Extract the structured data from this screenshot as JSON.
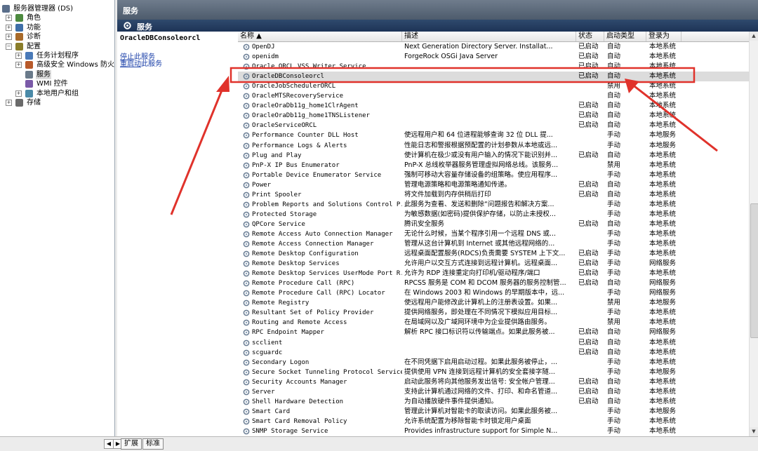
{
  "tree": [
    {
      "label": "服务器管理器 (DS)",
      "level": 0,
      "expander": "",
      "icon": "server-manager-icon"
    },
    {
      "label": "角色",
      "level": 1,
      "expander": "+",
      "icon": "roles-icon"
    },
    {
      "label": "功能",
      "level": 1,
      "expander": "+",
      "icon": "features-icon"
    },
    {
      "label": "诊断",
      "level": 1,
      "expander": "+",
      "icon": "diagnostics-icon"
    },
    {
      "label": "配置",
      "level": 1,
      "expander": "−",
      "icon": "configuration-icon"
    },
    {
      "label": "任务计划程序",
      "level": 2,
      "expander": "+",
      "icon": "task-scheduler-icon"
    },
    {
      "label": "高级安全 Windows 防火墙",
      "level": 2,
      "expander": "+",
      "icon": "firewall-icon"
    },
    {
      "label": "服务",
      "level": 2,
      "expander": "",
      "icon": "services-gear-icon",
      "selected": true
    },
    {
      "label": "WMI 控件",
      "level": 2,
      "expander": "",
      "icon": "wmi-icon"
    },
    {
      "label": "本地用户和组",
      "level": 2,
      "expander": "+",
      "icon": "users-groups-icon"
    },
    {
      "label": "存储",
      "level": 1,
      "expander": "+",
      "icon": "storage-icon"
    }
  ],
  "header": {
    "title": "服务"
  },
  "subheader": {
    "title": "服务"
  },
  "detail": {
    "title": "OracleDBConsoleorcl",
    "link1_link": "停止",
    "link1_rest": "此服务",
    "link2_link": "重启动",
    "link2_rest": "此服务"
  },
  "columns": {
    "name": "名称 ▲",
    "desc": "描述",
    "status": "状态",
    "startup": "启动类型",
    "logon": "登录为"
  },
  "rows": [
    {
      "name": "OpenDJ",
      "desc": "Next Generation Directory Server.  Installat...",
      "status": "已启动",
      "startup": "自动",
      "logon": "本地系统"
    },
    {
      "name": "openidm",
      "desc": "ForgeRock OSGi Java Server",
      "status": "已启动",
      "startup": "自动",
      "logon": "本地系统"
    },
    {
      "name": "Oracle ORCL VSS Writer Service",
      "desc": "",
      "status": "已启动",
      "startup": "自动",
      "logon": "本地系统"
    },
    {
      "name": "OracleDBConsoleorcl",
      "desc": "",
      "status": "已启动",
      "startup": "自动",
      "logon": "本地系统"
    },
    {
      "name": "OracleJobSchedulerORCL",
      "desc": "",
      "status": "",
      "startup": "禁用",
      "logon": "本地系统"
    },
    {
      "name": "OracleMTSRecoveryService",
      "desc": "",
      "status": "",
      "startup": "自动",
      "logon": "本地系统"
    },
    {
      "name": "OracleOraDb11g_home1ClrAgent",
      "desc": "",
      "status": "已启动",
      "startup": "自动",
      "logon": "本地系统"
    },
    {
      "name": "OracleOraDb11g_home1TNSListener",
      "desc": "",
      "status": "已启动",
      "startup": "自动",
      "logon": "本地系统"
    },
    {
      "name": "OracleServiceORCL",
      "desc": "",
      "status": "已启动",
      "startup": "自动",
      "logon": "本地系统"
    },
    {
      "name": "Performance Counter DLL Host",
      "desc": "使远程用户和 64 位进程能够查询 32 位 DLL 提...",
      "status": "",
      "startup": "手动",
      "logon": "本地服务"
    },
    {
      "name": "Performance Logs & Alerts",
      "desc": "性能日志和警报根据预配置的计划参数从本地或远...",
      "status": "",
      "startup": "手动",
      "logon": "本地服务"
    },
    {
      "name": "Plug and Play",
      "desc": "使计算机在极少或没有用户输入的情况下能识别并...",
      "status": "已启动",
      "startup": "自动",
      "logon": "本地系统"
    },
    {
      "name": "PnP-X IP Bus Enumerator",
      "desc": "PnP-X 总线枚举器服务管理虚拟网络总线。该服务...",
      "status": "",
      "startup": "禁用",
      "logon": "本地系统"
    },
    {
      "name": "Portable Device Enumerator Service",
      "desc": "强制可移动大容量存储设备的组策略。使应用程序...",
      "status": "",
      "startup": "手动",
      "logon": "本地系统"
    },
    {
      "name": "Power",
      "desc": "管理电源策略和电源策略通知传递。",
      "status": "已启动",
      "startup": "自动",
      "logon": "本地系统"
    },
    {
      "name": "Print Spooler",
      "desc": "将文件加载到内存供稍后打印",
      "status": "已启动",
      "startup": "自动",
      "logon": "本地系统"
    },
    {
      "name": "Problem Reports and Solutions Control P...",
      "desc": "此服务为查看、发送和删除“问题报告和解决方案...",
      "status": "",
      "startup": "手动",
      "logon": "本地系统"
    },
    {
      "name": "Protected Storage",
      "desc": "为敏感数据(如密码)提供保护存储，以防止未授权...",
      "status": "",
      "startup": "手动",
      "logon": "本地系统"
    },
    {
      "name": "QPCore Service",
      "desc": "腾讯安全服务",
      "status": "已启动",
      "startup": "自动",
      "logon": "本地系统"
    },
    {
      "name": "Remote Access Auto Connection Manager",
      "desc": "无论什么时候，当某个程序引用一个远程 DNS 或...",
      "status": "",
      "startup": "手动",
      "logon": "本地系统"
    },
    {
      "name": "Remote Access Connection Manager",
      "desc": "管理从这台计算机到 Internet 或其他远程网络的...",
      "status": "",
      "startup": "手动",
      "logon": "本地系统"
    },
    {
      "name": "Remote Desktop Configuration",
      "desc": "远程桌面配置服务(RDCS)负责需要 SYSTEM 上下文...",
      "status": "已启动",
      "startup": "手动",
      "logon": "本地系统"
    },
    {
      "name": "Remote Desktop Services",
      "desc": "允许用户以交互方式连接到远程计算机。远程桌面...",
      "status": "已启动",
      "startup": "手动",
      "logon": "网络服务"
    },
    {
      "name": "Remote Desktop Services UserMode Port R...",
      "desc": "允许为 RDP 连接重定向打印机/驱动程序/端口",
      "status": "已启动",
      "startup": "手动",
      "logon": "本地系统"
    },
    {
      "name": "Remote Procedure Call (RPC)",
      "desc": "RPCSS 服务是 COM 和 DCOM 服务器的服务控制管...",
      "status": "已启动",
      "startup": "自动",
      "logon": "网络服务"
    },
    {
      "name": "Remote Procedure Call (RPC) Locator",
      "desc": "在 Windows 2003 和 Windows 的早期版本中，远...",
      "status": "",
      "startup": "手动",
      "logon": "网络服务"
    },
    {
      "name": "Remote Registry",
      "desc": "使远程用户能修改此计算机上的注册表设置。如果...",
      "status": "",
      "startup": "禁用",
      "logon": "本地服务"
    },
    {
      "name": "Resultant Set of Policy Provider",
      "desc": "提供网络服务，即处理在不同情况下模拟应用目标...",
      "status": "",
      "startup": "手动",
      "logon": "本地系统"
    },
    {
      "name": "Routing and Remote Access",
      "desc": "在局域网以及广域网环境中为企业提供路由服务。",
      "status": "",
      "startup": "禁用",
      "logon": "本地系统"
    },
    {
      "name": "RPC Endpoint Mapper",
      "desc": "解析 RPC 接口标识符以传输端点。如果此服务被...",
      "status": "已启动",
      "startup": "自动",
      "logon": "网络服务"
    },
    {
      "name": "scclient",
      "desc": "",
      "status": "已启动",
      "startup": "自动",
      "logon": "本地系统"
    },
    {
      "name": "scguardc",
      "desc": "",
      "status": "已启动",
      "startup": "自动",
      "logon": "本地系统"
    },
    {
      "name": "Secondary Logon",
      "desc": "在不同凭据下启用启动过程。如果此服务被停止，...",
      "status": "",
      "startup": "手动",
      "logon": "本地系统"
    },
    {
      "name": "Secure Socket Tunneling Protocol Service",
      "desc": "提供使用 VPN 连接到远程计算机的安全套接字隧...",
      "status": "",
      "startup": "手动",
      "logon": "本地服务"
    },
    {
      "name": "Security Accounts Manager",
      "desc": "启动此服务将向其他服务发出信号: 安全帐户管理...",
      "status": "已启动",
      "startup": "自动",
      "logon": "本地系统"
    },
    {
      "name": "Server",
      "desc": "支持此计算机通过网络的文件、打印、和命名管道...",
      "status": "已启动",
      "startup": "自动",
      "logon": "本地系统"
    },
    {
      "name": "Shell Hardware Detection",
      "desc": "为自动播放硬件事件提供通知。",
      "status": "已启动",
      "startup": "自动",
      "logon": "本地系统"
    },
    {
      "name": "Smart Card",
      "desc": "管理此计算机对智能卡的取读访问。如果此服务被...",
      "status": "",
      "startup": "手动",
      "logon": "本地服务"
    },
    {
      "name": "Smart Card Removal Policy",
      "desc": "允许系统配置为移除智能卡时锁定用户桌面",
      "status": "",
      "startup": "手动",
      "logon": "本地系统"
    },
    {
      "name": "SNMP Storage Service",
      "desc": "Provides infrastructure support for Simple N...",
      "status": "",
      "startup": "手动",
      "logon": "本地系统"
    }
  ],
  "highlight_index": 3,
  "bottom_tabs": {
    "extended": "扩展",
    "standard": "标准"
  },
  "colors": {
    "annotation": "#e0322b",
    "header": "#4d5b6c",
    "subheader": "#1d3356",
    "link": "#1a3fa8"
  }
}
